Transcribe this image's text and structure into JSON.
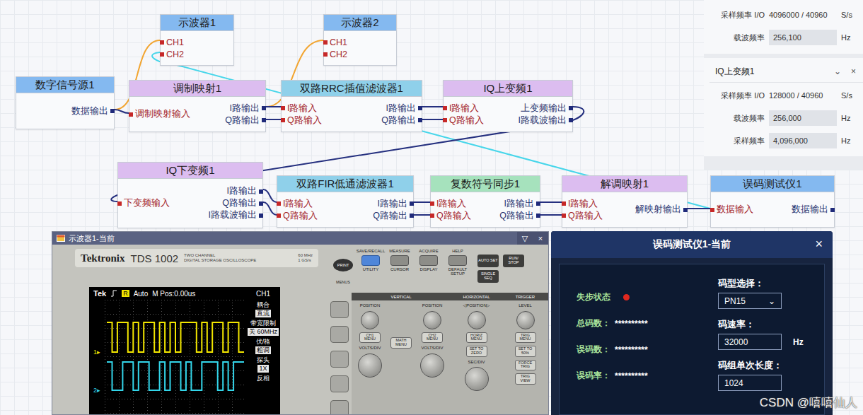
{
  "canvas": {
    "nodes": [
      {
        "title": "示波器1",
        "color": "#84b9f0",
        "inputs": [
          "CH1",
          "CH2"
        ],
        "outputs": []
      },
      {
        "title": "示波器2",
        "color": "#84b9f0",
        "inputs": [
          "CH1",
          "CH2"
        ],
        "outputs": []
      },
      {
        "title": "数字信号源1",
        "color": "#84b9f0",
        "inputs": [],
        "outputs": [
          "数据输出"
        ]
      },
      {
        "title": "调制映射1",
        "color": "#dcbdf0",
        "inputs": [
          "调制映射输入"
        ],
        "outputs": [
          "I路输出",
          "Q路输出"
        ]
      },
      {
        "title": "双路RRC插值滤波器1",
        "color": "#8fd0ea",
        "inputs": [
          "I路输入",
          "Q路输入"
        ],
        "outputs": [
          "I路输出",
          "Q路输出"
        ]
      },
      {
        "title": "IQ上变频1",
        "color": "#dcbdf0",
        "inputs": [
          "I路输入",
          "Q路输入"
        ],
        "outputs": [
          "上变频输出",
          "I路载波输出"
        ]
      },
      {
        "title": "IQ下变频1",
        "color": "#dcbdf0",
        "inputs": [
          "下变频输入"
        ],
        "outputs": [
          "I路输出",
          "Q路输出",
          "I路载波输出"
        ]
      },
      {
        "title": "双路FIR低通滤波器1",
        "color": "#8fd0ea",
        "inputs": [
          "I路输入",
          "Q路输入"
        ],
        "outputs": [
          "I路输出",
          "Q路输出"
        ]
      },
      {
        "title": "复数符号同步1",
        "color": "#a6e2bd",
        "inputs": [
          "I路输入",
          "Q路输入"
        ],
        "outputs": [
          "I路输出",
          "Q路输出"
        ]
      },
      {
        "title": "解调映射1",
        "color": "#dcbdf0",
        "inputs": [
          "I路输入",
          "Q路输入"
        ],
        "outputs": [
          "解映射输出"
        ]
      },
      {
        "title": "误码测试仪1",
        "color": "#84b9f0",
        "inputs": [
          "数据输入"
        ],
        "outputs": [
          "数据输出"
        ]
      }
    ]
  },
  "properties": {
    "upper_rows": [
      {
        "label": "采样频率 I/O",
        "value": "4096000 / 40960",
        "unit": "S/s",
        "kind": "text"
      },
      {
        "label": "载波频率",
        "value": "256,100",
        "unit": "Hz",
        "kind": "field"
      }
    ],
    "panel": {
      "title": "IQ上变频1",
      "expand_icon": "⌄",
      "close_icon": "×",
      "rows": [
        {
          "label": "采样频率 I/O",
          "value": "128000 / 40960",
          "unit": "S/s",
          "kind": "text"
        },
        {
          "label": "载波频率",
          "value": "256,000",
          "unit": "Hz",
          "kind": "field"
        },
        {
          "label": "采样频率",
          "value": "4,096,000",
          "unit": "Hz",
          "kind": "field"
        }
      ]
    }
  },
  "oscilloscope": {
    "title": "示波器1-当前",
    "title_buttons": [
      "▽",
      "×"
    ],
    "brand": "Tektronix",
    "model": "TDS 1002",
    "model_note": [
      "TWO CHANNEL",
      "DIGITAL STORAGE OSCILLOSCOPE"
    ],
    "spec": [
      "60 MHz",
      "1 GS/s"
    ],
    "screen": {
      "logo": "Tek",
      "trigger_badge": "R",
      "mode": "Auto",
      "position": "M Pos:0.00us",
      "menu_title": "CH1",
      "menu": [
        {
          "label": "耦合",
          "value": "直流"
        },
        {
          "label": "带宽限制",
          "value": "关 60MHz"
        },
        {
          "label": "伏/格",
          "value": "粗调"
        },
        {
          "label": "探头",
          "value": "1X"
        },
        {
          "label": "反相"
        }
      ],
      "traces": [
        {
          "label": "1",
          "color": "#f2e600",
          "values": [
            1,
            0,
            1,
            1,
            0,
            1,
            0,
            1,
            1,
            0,
            1,
            0,
            1,
            0,
            1,
            1,
            1,
            0,
            1,
            0,
            1,
            1,
            0,
            1,
            1,
            0
          ]
        },
        {
          "label": "2",
          "color": "#33d6ea",
          "values": [
            1,
            0,
            0,
            1,
            1,
            0,
            1,
            1,
            0,
            0,
            1,
            0,
            1,
            1,
            0,
            1,
            0,
            0,
            1,
            1,
            1,
            0,
            1,
            0,
            1,
            1
          ]
        }
      ]
    },
    "print": "PRINT",
    "menus_label": "MENUS",
    "menu_buttons": [
      {
        "top": "SAVE/RECALL",
        "bottom": "UTILITY",
        "lit": true
      },
      {
        "top": "MEASURE",
        "bottom": "CURSOR",
        "lit": false
      },
      {
        "top": "ACQUIRE",
        "bottom": "DISPLAY",
        "lit": false
      },
      {
        "top": "HELP",
        "bottom": "DEFAULT SETUP",
        "lit": false
      }
    ],
    "run_buttons": [
      "AUTO SET",
      "RUN/ STOP",
      "SINGLE SEQ"
    ],
    "vertical": {
      "label": "VERTICAL",
      "math": "MATH MENU",
      "channels": [
        {
          "position": "POSITION",
          "menu": "CH1 MENU",
          "scale": "VOLTS/DIV"
        },
        {
          "position": "POSITION",
          "menu": "CH2 MENU",
          "scale": "VOLTS/DIV"
        }
      ]
    },
    "horizontal": {
      "label": "HORIZONTAL",
      "position": "◁POSITION▷",
      "buttons": [
        "HORIZ MENU",
        "SET TO ZERO"
      ],
      "scale": "SEC/DIV"
    },
    "trigger": {
      "label": "TRIGGER",
      "level": "LEVEL",
      "buttons": [
        "TRIG MENU",
        "SET TO 50%",
        "FORCE TRIG",
        "TRIG VIEW"
      ]
    }
  },
  "ber_tester": {
    "title": "误码测试仪1-当前",
    "close_icon": "×",
    "sync": {
      "label": "失步状态",
      "out_of_sync": true
    },
    "stats": [
      {
        "label": "总码数：",
        "value": "**********"
      },
      {
        "label": "误码数：",
        "value": "**********"
      },
      {
        "label": "误码率：",
        "value": "**********"
      }
    ],
    "pattern": {
      "label": "码型选择：",
      "value": "PN15",
      "icon": "⌄"
    },
    "rate": {
      "label": "码速率：",
      "value": "32000",
      "unit": "Hz"
    },
    "block_length": {
      "label": "码组单次长度：",
      "value": "1024"
    }
  },
  "watermark": "CSDN @嘻嘻仙人"
}
